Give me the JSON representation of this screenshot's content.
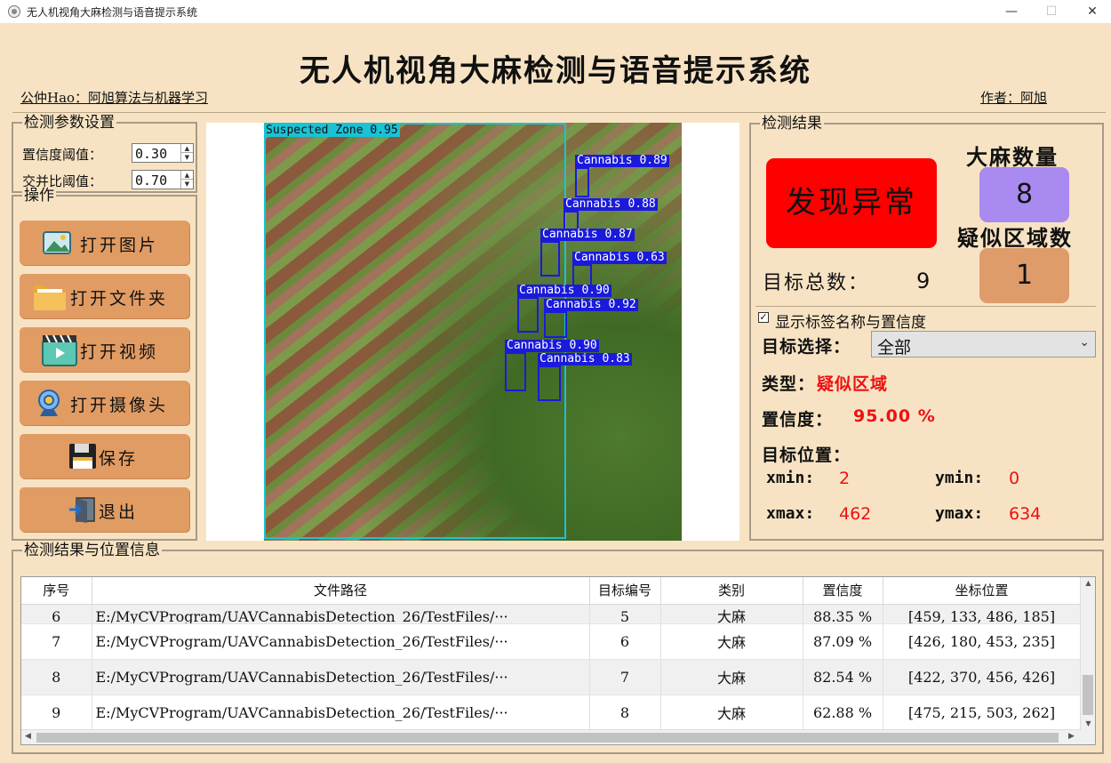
{
  "window": {
    "title": "无人机视角大麻检测与语音提示系统",
    "min_icon": "—",
    "max_icon": "☐",
    "close_icon": "✕"
  },
  "header": {
    "main_title": "无人机视角大麻检测与语音提示系统",
    "left_text": "公仲Hao：阿旭算法与机器学习",
    "right_text": "作者：阿旭"
  },
  "params": {
    "title": "检测参数设置",
    "conf_label": "置信度阈值：",
    "conf_value": "0.30",
    "iou_label": "交并比阈值：",
    "iou_value": "0.70"
  },
  "ops": {
    "title": "操作",
    "buttons": [
      {
        "label": "打开图片",
        "icon": "image-icon"
      },
      {
        "label": "打开文件夹",
        "icon": "folder-icon"
      },
      {
        "label": "打开视频",
        "icon": "video-icon"
      },
      {
        "label": "打开摄像头",
        "icon": "camera-icon"
      },
      {
        "label": "保存",
        "icon": "save-icon"
      },
      {
        "label": "退出",
        "icon": "exit-icon"
      }
    ]
  },
  "detections": [
    {
      "label": "Suspected Zone 0.95"
    },
    {
      "label": "Cannabis 0.89"
    },
    {
      "label": "Cannabis 0.88"
    },
    {
      "label": "Cannabis 0.87"
    },
    {
      "label": "Cannabis 0.63"
    },
    {
      "label": "Cannabis 0.90"
    },
    {
      "label": "Cannabis 0.92"
    },
    {
      "label": "Cannabis 0.90"
    },
    {
      "label": "Cannabis 0.83"
    }
  ],
  "results": {
    "title": "检测结果",
    "alert_text": "发现异常",
    "cannabis_count_label": "大麻数量",
    "cannabis_count": "8",
    "zone_count_label": "疑似区域数",
    "zone_count": "1",
    "total_label": "目标总数：",
    "total_value": "9",
    "show_label_text": "显示标签名称与置信度",
    "show_label_checked": "✓",
    "target_select_label": "目标选择：",
    "target_select_value": "全部",
    "type_label": "类型：",
    "type_value": "疑似区域",
    "conf_label": "置信度：",
    "conf_value": "95.00 %",
    "pos_label": "目标位置：",
    "xmin_label": "xmin:",
    "xmin_value": "2",
    "ymin_label": "ymin:",
    "ymin_value": "0",
    "xmax_label": "xmax:",
    "xmax_value": "462",
    "ymax_label": "ymax:",
    "ymax_value": "634"
  },
  "table": {
    "title": "检测结果与位置信息",
    "headers": [
      "序号",
      "文件路径",
      "目标编号",
      "类别",
      "置信度",
      "坐标位置"
    ],
    "rows": [
      [
        "6",
        "E:/MyCVProgram/UAVCannabisDetection_26/TestFiles/···",
        "5",
        "大麻",
        "88.35 %",
        "[459, 133, 486, 185]"
      ],
      [
        "7",
        "E:/MyCVProgram/UAVCannabisDetection_26/TestFiles/···",
        "6",
        "大麻",
        "87.09 %",
        "[426, 180, 453, 235]"
      ],
      [
        "8",
        "E:/MyCVProgram/UAVCannabisDetection_26/TestFiles/···",
        "7",
        "大麻",
        "82.54 %",
        "[422, 370, 456, 426]"
      ],
      [
        "9",
        "E:/MyCVProgram/UAVCannabisDetection_26/TestFiles/···",
        "8",
        "大麻",
        "62.88 %",
        "[475, 215, 503, 262]"
      ]
    ]
  }
}
